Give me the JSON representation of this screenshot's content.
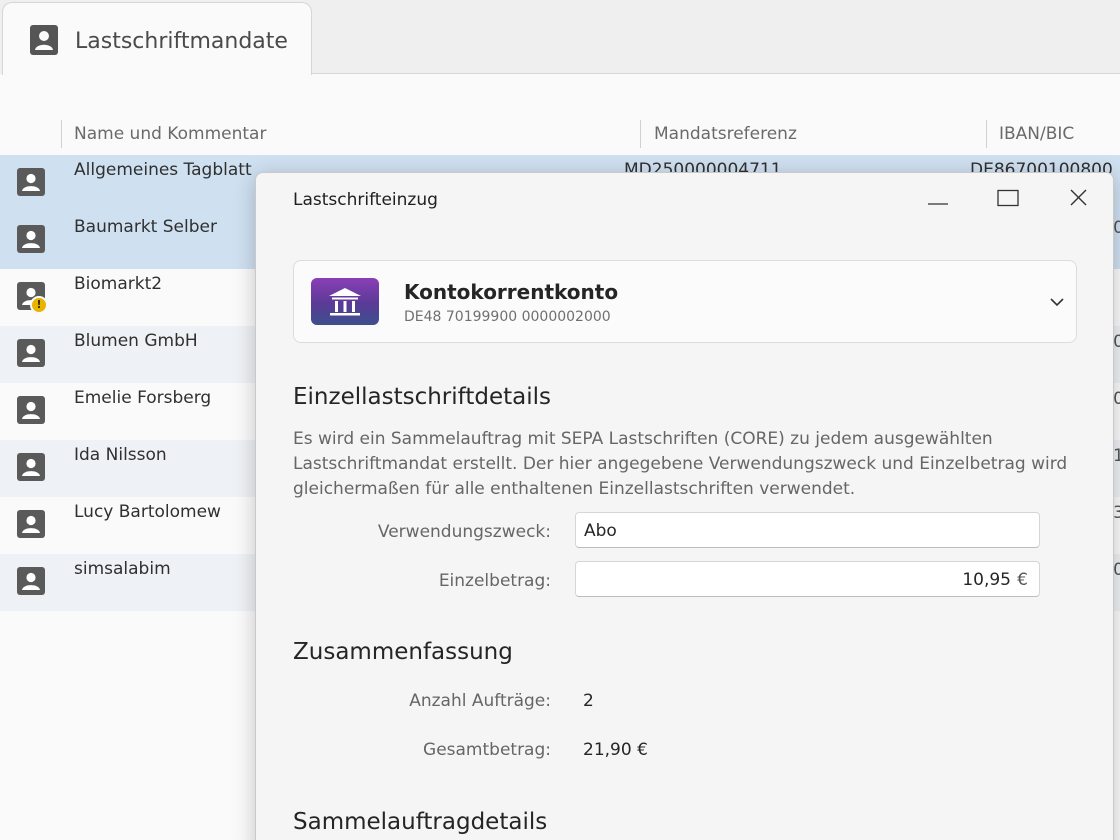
{
  "tab": {
    "title": "Lastschriftmandate",
    "icon": "contact-card-icon"
  },
  "columns": [
    "Name und Kommentar",
    "Mandatsreferenz",
    "IBAN/BIC"
  ],
  "rows": [
    {
      "name": "Allgemeines Tagblatt",
      "ref": "MD250000004711",
      "iban": "DE86700100800",
      "edge": "",
      "state": "selected",
      "warning": false
    },
    {
      "name": "Baumarkt Selber",
      "ref": "",
      "iban": "",
      "edge": "0",
      "state": "selected",
      "warning": false
    },
    {
      "name": "Biomarkt2",
      "ref": "",
      "iban": "",
      "edge": "",
      "state": "plain",
      "warning": true
    },
    {
      "name": "Blumen GmbH",
      "ref": "",
      "iban": "",
      "edge": "0",
      "state": "alt",
      "warning": false
    },
    {
      "name": "Emelie Forsberg",
      "ref": "",
      "iban": "",
      "edge": "0",
      "state": "plain",
      "warning": false
    },
    {
      "name": "Ida Nilsson",
      "ref": "",
      "iban": "",
      "edge": "1",
      "state": "alt",
      "warning": false
    },
    {
      "name": "Lucy Bartolomew",
      "ref": "",
      "iban": "",
      "edge": "3",
      "state": "plain",
      "warning": false
    },
    {
      "name": "simsalabim",
      "ref": "",
      "iban": "",
      "edge": "0",
      "state": "alt",
      "warning": false
    }
  ],
  "dialog": {
    "title": "Lastschrifteinzug",
    "account": {
      "name": "Kontokorrentkonto",
      "iban": "DE48 70199900 0000002000",
      "icon": "bank-icon"
    },
    "details_heading": "Einzellastschriftdetails",
    "details_description": "Es wird ein Sammelauftrag mit SEPA Lastschriften (CORE) zu jedem ausgewählten Lastschriftmandat erstellt. Der hier angegebene Verwendungszweck und Einzelbetrag wird gleichermaßen für alle enthaltenen Einzellastschriften verwendet.",
    "purpose_label": "Verwendungszweck:",
    "purpose_value": "Abo",
    "amount_label": "Einzelbetrag:",
    "amount_value": "10,95",
    "amount_unit": "€",
    "summary_heading": "Zusammenfassung",
    "count_label": "Anzahl Aufträge:",
    "count_value": "2",
    "total_label": "Gesamtbetrag:",
    "total_value": "21,90 €",
    "batch_heading": "Sammelauftragdetails"
  },
  "colors": {
    "selected_row": "#cfe0f1",
    "alt_row": "#eef1f5",
    "warning": "#e8b400",
    "bank_gradient_top": "#8a3fb6",
    "bank_gradient_bottom": "#3c4f8d"
  }
}
